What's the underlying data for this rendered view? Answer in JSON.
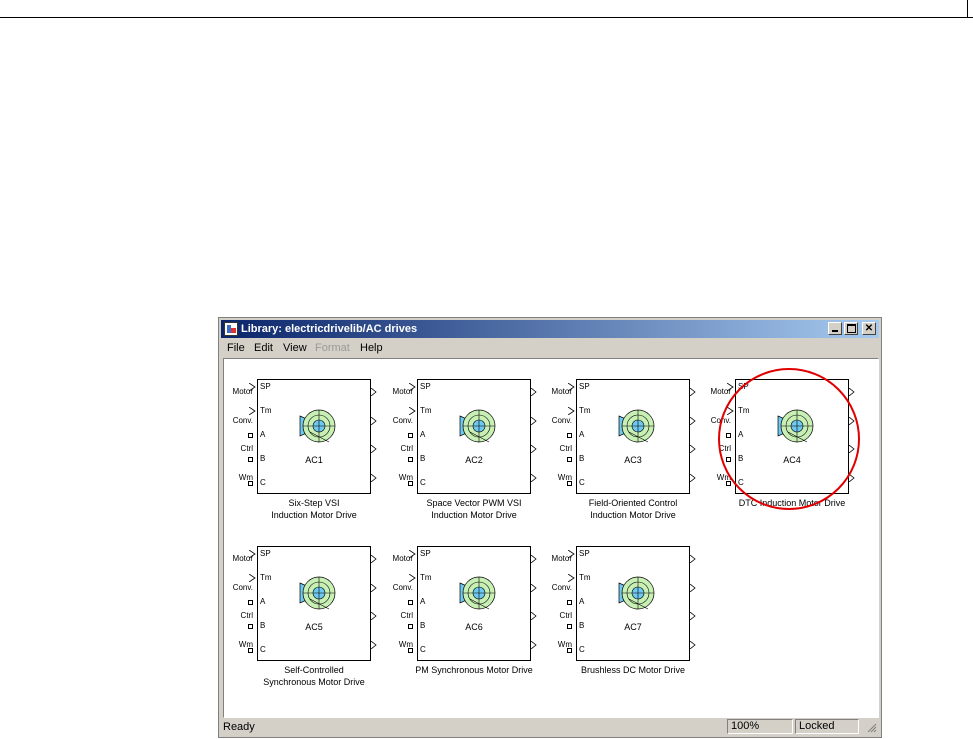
{
  "window": {
    "title": "Library: electricdrivelib/AC drives",
    "controls": {
      "minimize": "minimize-icon",
      "maximize": "maximize-icon",
      "close": "close-icon"
    }
  },
  "menu": [
    {
      "label": "File",
      "enabled": true
    },
    {
      "label": "Edit",
      "enabled": true
    },
    {
      "label": "View",
      "enabled": true
    },
    {
      "label": "Format",
      "enabled": false
    },
    {
      "label": "Help",
      "enabled": true
    }
  ],
  "ports": {
    "inputs": [
      "SP",
      "Tm"
    ],
    "connections": [
      "A",
      "B",
      "C"
    ],
    "outputs": [
      "Motor",
      "Conv.",
      "Ctrl",
      "Wm"
    ]
  },
  "blocks": [
    {
      "id": "AC1",
      "caption": [
        "Six-Step VSI",
        "Induction Motor Drive"
      ]
    },
    {
      "id": "AC2",
      "caption": [
        "Space Vector PWM VSI",
        "Induction Motor Drive"
      ]
    },
    {
      "id": "AC3",
      "caption": [
        "Field-Oriented Control",
        "Induction Motor Drive"
      ]
    },
    {
      "id": "AC4",
      "caption": [
        "DTC Induction Motor Drive"
      ],
      "highlighted": true
    },
    {
      "id": "AC5",
      "caption": [
        "Self-Controlled",
        "Synchronous Motor Drive"
      ]
    },
    {
      "id": "AC6",
      "caption": [
        "PM Synchronous Motor Drive"
      ]
    },
    {
      "id": "AC7",
      "caption": [
        "Brushless DC Motor Drive"
      ]
    }
  ],
  "icon_names": {
    "motor": "motor-icon",
    "highlight": "red-circle-annotation"
  },
  "colors": {
    "highlight": "#e00000",
    "motor_fill": "#c8f0b4",
    "drive_fill": "#6ec8f0"
  },
  "status": {
    "text": "Ready",
    "zoom": "100%",
    "lock": "Locked"
  }
}
